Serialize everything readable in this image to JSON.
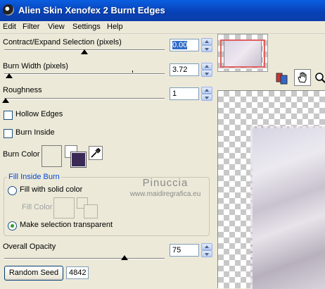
{
  "window": {
    "title": "Alien Skin Xenofex 2 Burnt Edges"
  },
  "menu": [
    "Edit",
    "Filter",
    "View",
    "Settings",
    "Help"
  ],
  "controls": {
    "contract": {
      "label": "Contract/Expand Selection (pixels)",
      "value": "0.00"
    },
    "burn_width": {
      "label": "Burn Width (pixels)",
      "value": "3.72"
    },
    "roughness": {
      "label": "Roughness",
      "value": "1"
    },
    "hollow_edges": {
      "label": "Hollow Edges",
      "checked": false
    },
    "burn_inside": {
      "label": "Burn Inside",
      "checked": false
    },
    "burn_color": {
      "label": "Burn Color",
      "swatch_color": "#ece9d8",
      "stacked_color": "#3a2a55"
    },
    "fill_group": {
      "legend": "Fill Inside Burn",
      "option_solid": "Fill with solid color",
      "fill_color_label": "Fill Color",
      "option_transparent": "Make selection transparent",
      "selected": "transparent"
    },
    "opacity": {
      "label": "Overall Opacity",
      "value": "75"
    },
    "random_seed": {
      "button_label": "Random Seed",
      "value": "4842"
    }
  },
  "watermark": {
    "name": "Pinuccia",
    "site": "www.maidiregrafica.eu"
  },
  "toolbar_icons": [
    "compare-icon",
    "hand-icon",
    "zoom-icon"
  ]
}
